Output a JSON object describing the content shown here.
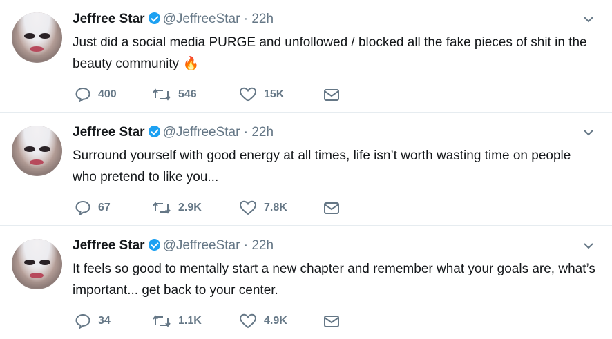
{
  "tweets": [
    {
      "name": "Jeffree Star",
      "handle": "@JeffreeStar",
      "separator": "·",
      "time": "22h",
      "text": "Just did a social media PURGE and unfollowed / blocked all the fake pieces of shit in the beauty community",
      "emoji": "🔥",
      "replies": "400",
      "retweets": "546",
      "likes": "15K"
    },
    {
      "name": "Jeffree Star",
      "handle": "@JeffreeStar",
      "separator": "·",
      "time": "22h",
      "text": "Surround yourself with good energy at all times, life isn’t worth wasting time on people who pretend to like you...",
      "emoji": "",
      "replies": "67",
      "retweets": "2.9K",
      "likes": "7.8K"
    },
    {
      "name": "Jeffree Star",
      "handle": "@JeffreeStar",
      "separator": "·",
      "time": "22h",
      "text": "It feels so good to mentally start a new chapter and remember what your goals are, what’s important... get back to your center.",
      "emoji": "",
      "replies": "34",
      "retweets": "1.1K",
      "likes": "4.9K"
    }
  ],
  "icons": {
    "reply": "reply-icon",
    "retweet": "retweet-icon",
    "like": "heart-icon",
    "dm": "envelope-icon",
    "verified": "verified-badge-icon",
    "more": "chevron-down-icon"
  },
  "colors": {
    "text": "#14171a",
    "muted": "#657786",
    "verified": "#1da1f2",
    "divider": "#e6ecf0"
  }
}
